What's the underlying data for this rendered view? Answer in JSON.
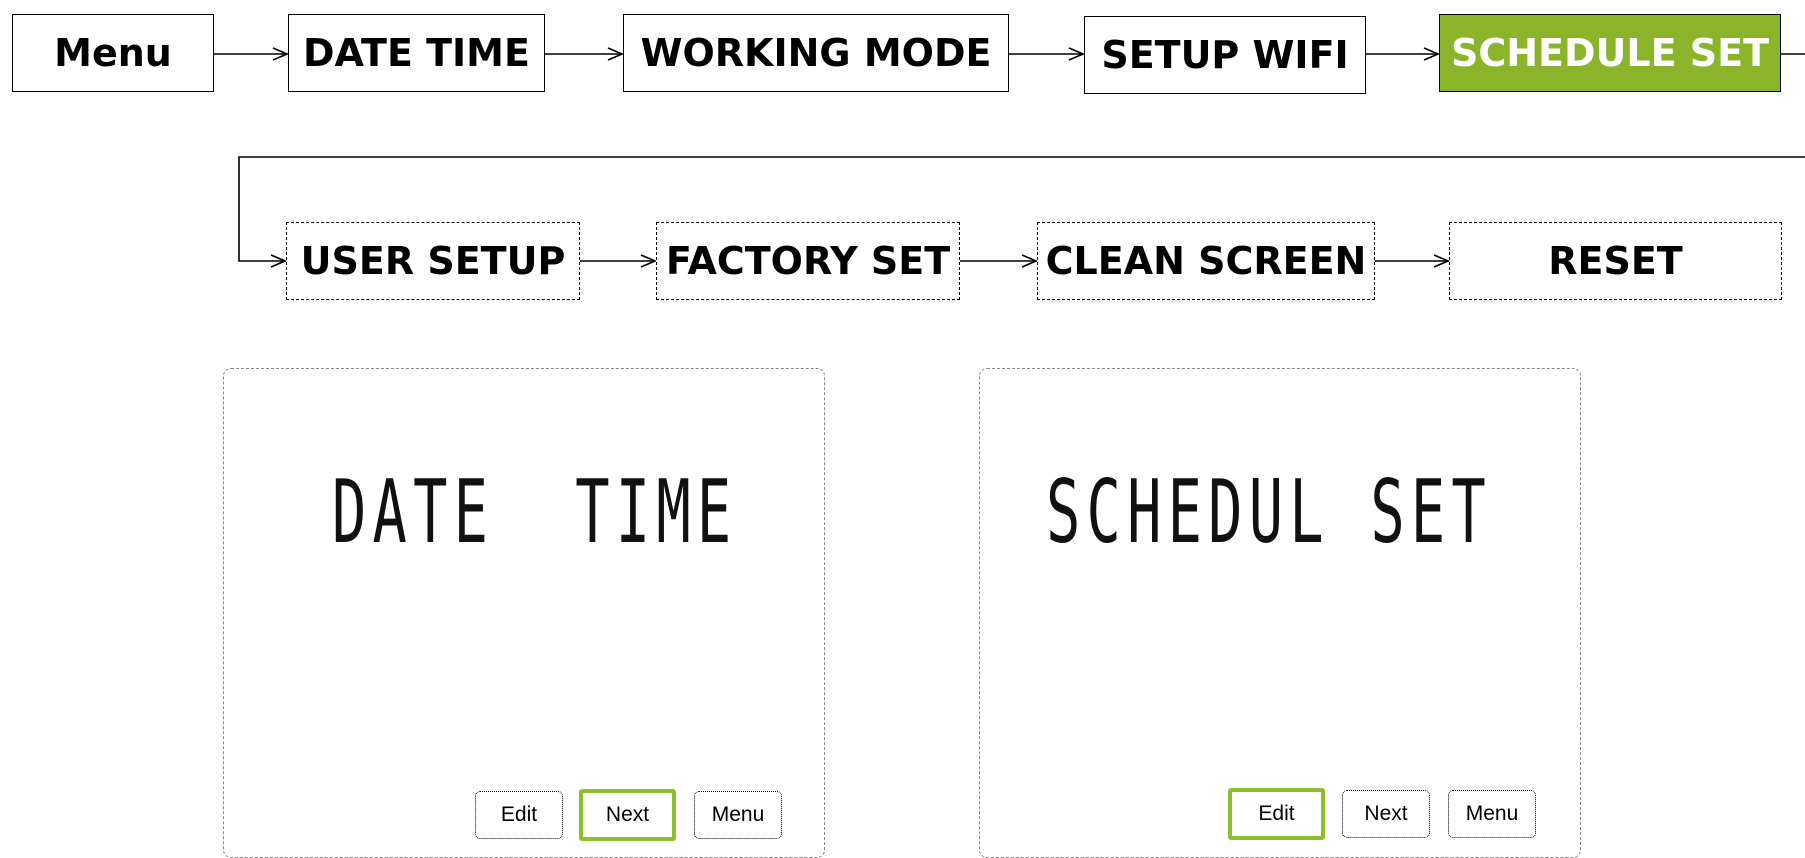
{
  "colors": {
    "accent": "#8ab52a"
  },
  "flow_row1": [
    {
      "label": "Menu"
    },
    {
      "label": "DATE TIME"
    },
    {
      "label": "WORKING MODE"
    },
    {
      "label": "SETUP WIFI"
    },
    {
      "label": "SCHEDULE SET",
      "highlighted": true
    }
  ],
  "flow_row2": [
    {
      "label": "USER SETUP"
    },
    {
      "label": "FACTORY SET"
    },
    {
      "label": "CLEAN SCREEN"
    },
    {
      "label": "RESET"
    }
  ],
  "screens": [
    {
      "display_text": "DATE  TIME",
      "buttons": [
        {
          "label": "Edit",
          "active": false
        },
        {
          "label": "Next",
          "active": true
        },
        {
          "label": "Menu",
          "active": false
        }
      ]
    },
    {
      "display_text": "SCHEDUL SET",
      "buttons": [
        {
          "label": "Edit",
          "active": true
        },
        {
          "label": "Next",
          "active": false
        },
        {
          "label": "Menu",
          "active": false
        }
      ]
    }
  ]
}
